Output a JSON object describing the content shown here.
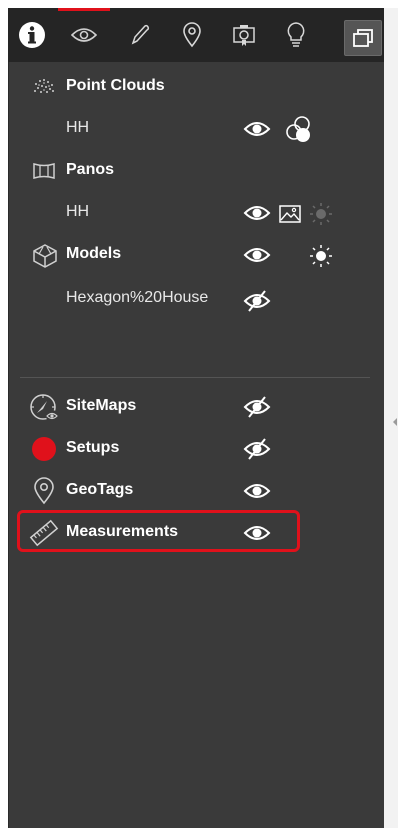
{
  "toolbar": {
    "tools": [
      {
        "icon": "info-icon",
        "active": false
      },
      {
        "icon": "eye-icon",
        "active": true
      },
      {
        "icon": "pen-icon",
        "active": false
      },
      {
        "icon": "map-pin-icon",
        "active": false
      },
      {
        "icon": "camera-bookmark-icon",
        "active": false
      },
      {
        "icon": "lightbulb-icon",
        "active": false
      },
      {
        "icon": "window-icon",
        "active": false
      }
    ]
  },
  "layers": {
    "point_clouds": {
      "label": "Point Clouds",
      "icon": "point-cloud-icon",
      "item": "HH",
      "visible": true
    },
    "panos": {
      "label": "Panos",
      "icon": "pano-icon",
      "item": "HH",
      "visible": true
    },
    "models": {
      "label": "Models",
      "icon": "model-cube-icon",
      "visible": true,
      "item": "Hexagon%20House",
      "item_visible": false
    }
  },
  "overlays": {
    "sitemaps": {
      "label": "SiteMaps",
      "icon": "sitemap-compass-icon",
      "visible": false
    },
    "setups": {
      "label": "Setups",
      "icon": "red-circle-icon",
      "visible": false,
      "color": "#e0111b"
    },
    "geotags": {
      "label": "GeoTags",
      "icon": "geotag-pin-icon",
      "visible": true
    },
    "measurements": {
      "label": "Measurements",
      "icon": "ruler-icon",
      "visible": true,
      "highlighted": true
    }
  },
  "colors": {
    "accent": "#e0111b",
    "panel": "#3a3a3a",
    "toolbar": "#252525"
  }
}
